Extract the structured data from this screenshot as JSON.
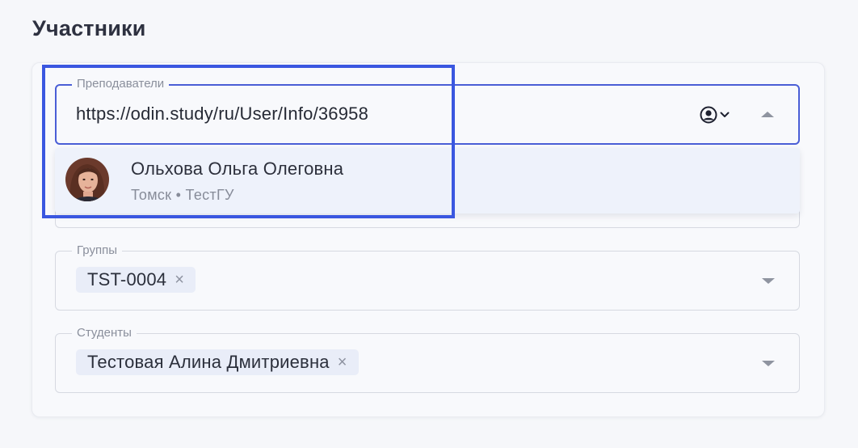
{
  "page_title": "Участники",
  "teachers": {
    "label": "Преподаватели",
    "value": "https://odin.study/ru/User/Info/36958",
    "icons": {
      "person": "user-circle-icon",
      "toggle": "chevron-down-icon",
      "collapse": "caret-up-icon"
    },
    "suggestion": {
      "name": "Ольхова Ольга Олеговна",
      "meta": "Томск • ТестГУ",
      "avatar": "avatar-photo"
    }
  },
  "groups": {
    "label": "Группы",
    "chips": [
      {
        "label": "TST-0004",
        "remove": "×"
      }
    ]
  },
  "students": {
    "label": "Студенты",
    "chips": [
      {
        "label": "Тестовая Алина Дмитриевна",
        "remove": "×"
      }
    ]
  },
  "colors": {
    "accent": "#4a5ed6",
    "highlight": "#3a57e0",
    "chip_bg": "#e9edf8",
    "dropdown_bg": "#eef2fb"
  }
}
